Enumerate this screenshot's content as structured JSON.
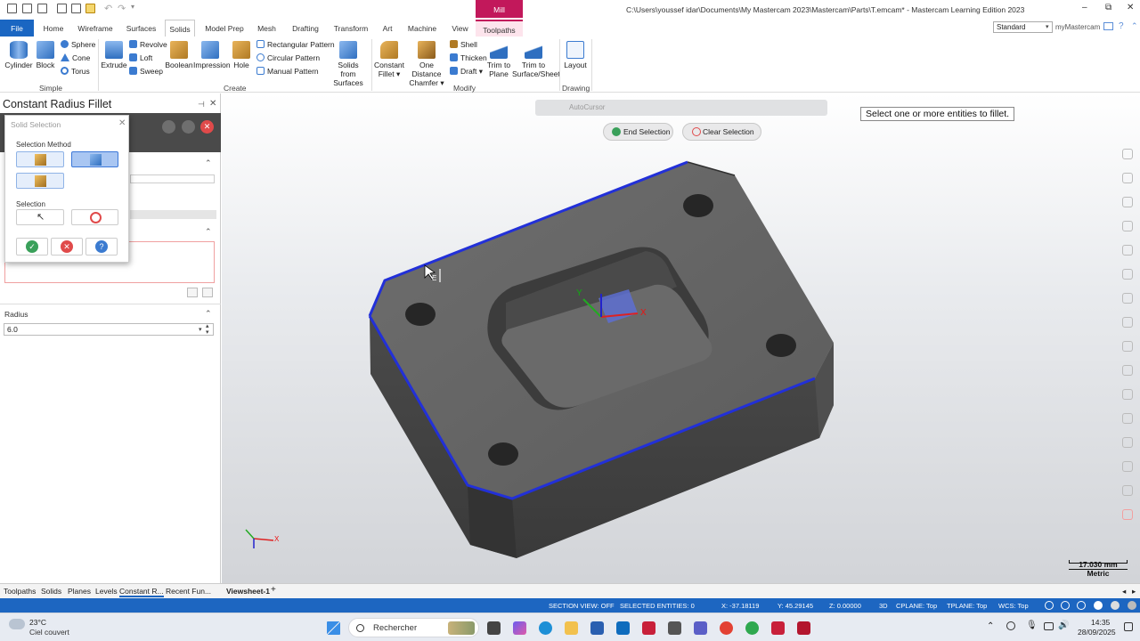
{
  "window": {
    "title": "C:\\Users\\youssef idar\\Documents\\My Mastercam 2023\\Mastercam\\Parts\\T.emcam* - Mastercam Learning Edition 2023",
    "context_tab": "Mill"
  },
  "tabs": [
    "File",
    "Home",
    "Wireframe",
    "Surfaces",
    "Solids",
    "Model Prep",
    "Mesh",
    "Drafting",
    "Transform",
    "Art",
    "Machine",
    "View",
    "Toolpaths"
  ],
  "active_tab": "Solids",
  "workspace": "Standard",
  "account": "myMastercam",
  "ribbon": {
    "simple": {
      "cylinder": "Cylinder",
      "block": "Block",
      "sphere": "Sphere",
      "cone": "Cone",
      "torus": "Torus",
      "group": "Simple"
    },
    "create": {
      "extrude": "Extrude",
      "revolve": "Revolve",
      "loft": "Loft",
      "sweep": "Sweep",
      "boolean": "Boolean",
      "impression": "Impression",
      "hole": "Hole",
      "rect_pattern": "Rectangular Pattern",
      "circ_pattern": "Circular Pattern",
      "manual_pattern": "Manual Pattern",
      "solids_from_surfaces_1": "Solids from",
      "solids_from_surfaces_2": "Surfaces",
      "group": "Create"
    },
    "modify": {
      "constant_fillet_1": "Constant",
      "constant_fillet_2": "Fillet",
      "one_distance_1": "One Distance",
      "one_distance_2": "Chamfer",
      "shell": "Shell",
      "thicken": "Thicken",
      "draft": "Draft",
      "trim_plane_1": "Trim to",
      "trim_plane_2": "Plane",
      "trim_surface_1": "Trim to",
      "trim_surface_2": "Surface/Sheet",
      "group": "Modify"
    },
    "drawing": {
      "layout": "Layout",
      "group": "Drawing"
    }
  },
  "panel": {
    "title": "Constant Radius Fillet",
    "radius_label": "Radius",
    "radius_value": "6.0"
  },
  "dialog": {
    "title": "Solid Selection",
    "selection_method_label": "Selection Method",
    "selection_label": "Selection"
  },
  "viewport": {
    "autocursor": "AutoCursor",
    "end_selection": "End Selection",
    "clear_selection": "Clear Selection",
    "prompt": "Select one or more entities to fillet.",
    "scale_value": "17.030 mm",
    "scale_unit": "Metric",
    "axis_x": "X",
    "axis_y": "Y",
    "cursor_tag": "E"
  },
  "bottom_tabs": [
    "Toolpaths",
    "Solids",
    "Planes",
    "Levels",
    "Constant R...",
    "Recent Fun..."
  ],
  "viewsheet": "Viewsheet-1",
  "status": {
    "section_view": "SECTION VIEW: OFF",
    "selected": "SELECTED ENTITIES: 0",
    "x": "X:  -37.18119",
    "y": "Y:  45.29145",
    "z": "Z:  0.00000",
    "mode": "3D",
    "cplane": "CPLANE: Top",
    "tplane": "TPLANE: Top",
    "wcs": "WCS: Top"
  },
  "taskbar": {
    "temp": "23°C",
    "weather": "Ciel couvert",
    "search": "Rechercher",
    "time": "14:35",
    "date": "28/09/2025"
  }
}
